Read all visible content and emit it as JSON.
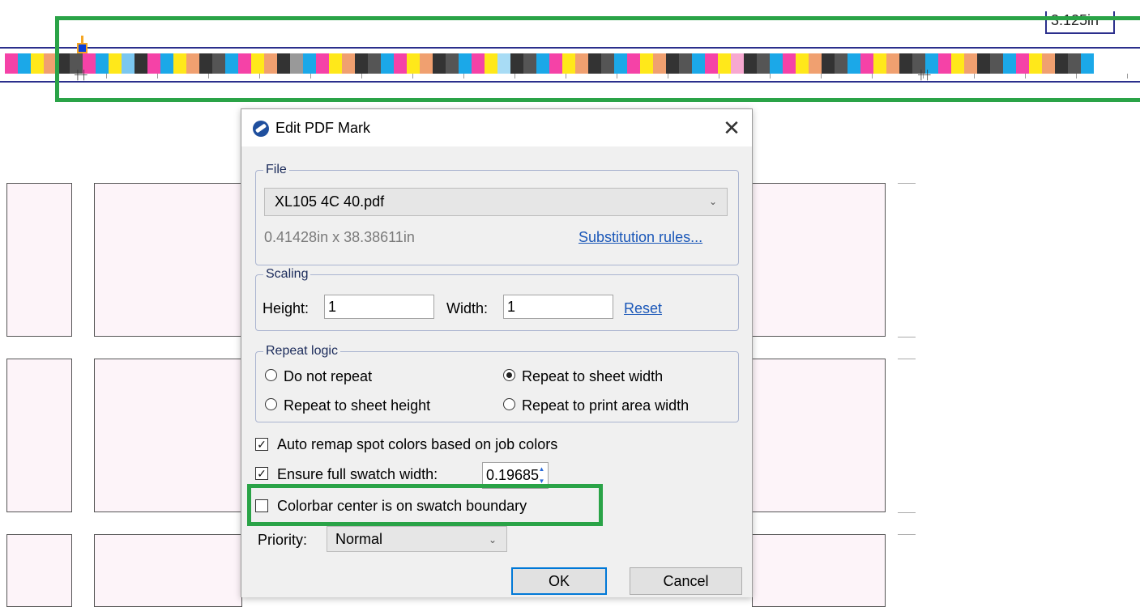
{
  "canvas": {
    "dimension_label": "3.125in",
    "swatch_colors": [
      "#f542a7",
      "#1ba8e8",
      "#ffe81a",
      "#f0a070",
      "#333333",
      "#555555",
      "#f542a7",
      "#1ba8e8",
      "#ffe81a",
      "#7bc7f0",
      "#333333",
      "#f542a7",
      "#1ba8e8",
      "#ffe81a",
      "#f0a070",
      "#333333",
      "#555555",
      "#1ba8e8",
      "#f542a7",
      "#ffe81a",
      "#f0a070",
      "#333333",
      "#999999",
      "#1ba8e8",
      "#f542a7",
      "#ffe81a",
      "#f0a070",
      "#333333",
      "#555555",
      "#1ba8e8",
      "#f542a7",
      "#ffe81a",
      "#f0a070",
      "#333333",
      "#555555",
      "#1ba8e8",
      "#f542a7",
      "#ffe81a",
      "#a8dcf5",
      "#333333",
      "#555555",
      "#1ba8e8",
      "#f542a7",
      "#ffe81a",
      "#f0a070",
      "#333333",
      "#555555",
      "#1ba8e8",
      "#f542a7",
      "#ffe81a",
      "#f0a070",
      "#333333",
      "#555555",
      "#1ba8e8",
      "#f542a7",
      "#ffe81a",
      "#f7a8d0",
      "#333333",
      "#555555",
      "#1ba8e8",
      "#f542a7",
      "#ffe81a",
      "#f0a070",
      "#333333",
      "#555555",
      "#1ba8e8",
      "#f542a7",
      "#ffe81a",
      "#f0a070",
      "#333333",
      "#555555",
      "#1ba8e8",
      "#f542a7",
      "#ffe81a",
      "#f0a070",
      "#333333",
      "#555555",
      "#1ba8e8",
      "#f542a7",
      "#ffe81a",
      "#f0a070",
      "#333333",
      "#555555",
      "#1ba8e8"
    ]
  },
  "dialog": {
    "title": "Edit PDF Mark",
    "close_glyph": "✕",
    "file": {
      "legend": "File",
      "selected_file": "XL105 4C 40.pdf",
      "dimensions": "0.41428in x 38.38611in",
      "substitution_link": "Substitution rules..."
    },
    "scaling": {
      "legend": "Scaling",
      "height_label": "Height:",
      "height_value": "1",
      "width_label": "Width:",
      "width_value": "1",
      "reset_link": "Reset"
    },
    "repeat_logic": {
      "legend": "Repeat logic",
      "options": [
        {
          "label": "Do not repeat",
          "checked": false
        },
        {
          "label": "Repeat to sheet width",
          "checked": true
        },
        {
          "label": "Repeat to sheet height",
          "checked": false
        },
        {
          "label": "Repeat to print area width",
          "checked": false
        }
      ]
    },
    "options": {
      "auto_remap_label": "Auto remap spot colors based on job colors",
      "auto_remap_checked": true,
      "ensure_swatch_label": "Ensure full swatch width:",
      "ensure_swatch_checked": true,
      "swatch_width_value": "0.19685",
      "center_label": "Colorbar center is on swatch boundary",
      "center_checked": false
    },
    "priority": {
      "label": "Priority:",
      "value": "Normal"
    },
    "buttons": {
      "ok": "OK",
      "cancel": "Cancel"
    }
  },
  "colors": {
    "highlight_green": "#2aa347",
    "link_blue": "#1a57b8",
    "handle_blue": "#0a3fd8"
  }
}
